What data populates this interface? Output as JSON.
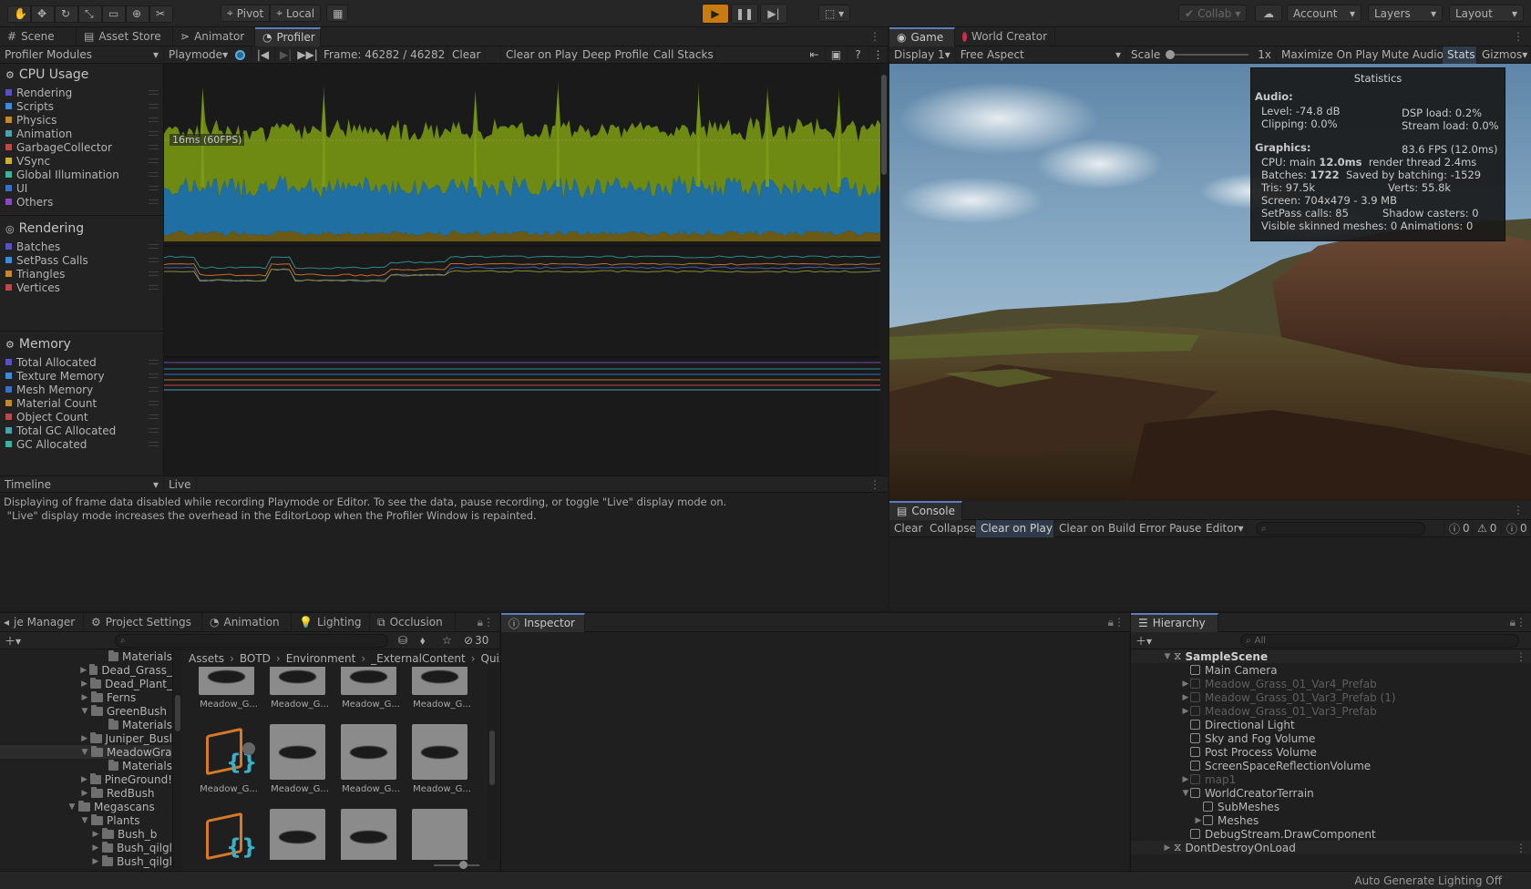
{
  "toolbar": {
    "pivot": "Pivot",
    "local": "Local",
    "collab": "Collab",
    "account": "Account",
    "layers": "Layers",
    "layout": "Layout"
  },
  "left_tabs": [
    "Scene",
    "Asset Store",
    "Animator",
    "Profiler"
  ],
  "profiler": {
    "modules_label": "Profiler Modules",
    "playmode": "Playmode",
    "frame": "Frame: 46282 / 46282",
    "clear": "Clear",
    "clear_on_play": "Clear on Play",
    "deep_profile": "Deep Profile",
    "call_stacks": "Call Stacks",
    "fps_marker": "16ms (60FPS)",
    "cpu": {
      "title": "CPU Usage",
      "items": [
        {
          "label": "Rendering",
          "color": "#5b4fc4"
        },
        {
          "label": "Scripts",
          "color": "#3d8ad6"
        },
        {
          "label": "Physics",
          "color": "#c08a2a"
        },
        {
          "label": "Animation",
          "color": "#4aa3a8"
        },
        {
          "label": "GarbageCollector",
          "color": "#b94a4a"
        },
        {
          "label": "VSync",
          "color": "#c8b430"
        },
        {
          "label": "Global Illumination",
          "color": "#3bb39a"
        },
        {
          "label": "UI",
          "color": "#3a6fc4"
        },
        {
          "label": "Others",
          "color": "#8a4ab8"
        }
      ]
    },
    "rendering": {
      "title": "Rendering",
      "items": [
        {
          "label": "Batches",
          "color": "#5b4fc4"
        },
        {
          "label": "SetPass Calls",
          "color": "#3d8ad6"
        },
        {
          "label": "Triangles",
          "color": "#c08a2a"
        },
        {
          "label": "Vertices",
          "color": "#b94a4a"
        }
      ]
    },
    "memory": {
      "title": "Memory",
      "items": [
        {
          "label": "Total Allocated",
          "color": "#5b4fc4"
        },
        {
          "label": "Texture Memory",
          "color": "#3d8ad6"
        },
        {
          "label": "Mesh Memory",
          "color": "#3a6fc4"
        },
        {
          "label": "Material Count",
          "color": "#c08a2a"
        },
        {
          "label": "Object Count",
          "color": "#b94a4a"
        },
        {
          "label": "Total GC Allocated",
          "color": "#4aa3a8"
        },
        {
          "label": "GC Allocated",
          "color": "#3bb39a"
        }
      ]
    },
    "timeline_label": "Timeline",
    "live_label": "Live",
    "message_line1": "Displaying of frame data disabled while recording Playmode or Editor. To see the data, pause recording, or toggle \"Live\" display mode on.",
    "message_line2": " \"Live\" display mode increases the overhead in the EditorLoop when the Profiler Window is repainted."
  },
  "game": {
    "tab": "Game",
    "tab2": "World Creator",
    "display": "Display 1",
    "aspect": "Free Aspect",
    "scale_label": "Scale",
    "scale_value": "1x",
    "maximize": "Maximize On Play",
    "mute": "Mute Audio",
    "stats": "Stats",
    "gizmos": "Gizmos"
  },
  "stats": {
    "title": "Statistics",
    "audio_label": "Audio:",
    "level": "Level: -74.8 dB",
    "dsp": "DSP load: 0.2%",
    "clipping": "Clipping: 0.0%",
    "stream": "Stream load: 0.0%",
    "graphics_label": "Graphics:",
    "fps": "83.6 FPS (12.0ms)",
    "cpu_prefix": "CPU: main ",
    "cpu_main": "12.0ms",
    "cpu_suffix": "  render thread 2.4ms",
    "batches_prefix": "Batches: ",
    "batches": "1722",
    "saved": "  Saved by batching: -1529",
    "tris": "Tris: 97.5k",
    "verts": "Verts: 55.8k",
    "screen": "Screen: 704x479 - 3.9 MB",
    "setpass": "SetPass calls: 85",
    "shadow": "Shadow casters: 0",
    "skinned": "Visible skinned meshes: 0  Animations: 0"
  },
  "console": {
    "tab": "Console",
    "clear": "Clear",
    "collapse": "Collapse",
    "clear_on_play": "Clear on Play",
    "clear_on_build": "Clear on Build",
    "error_pause": "Error Pause",
    "editor": "Editor",
    "count_info": "0",
    "count_warn": "0",
    "count_err": "0"
  },
  "bottom_tabs": [
    "je Manager",
    "Project Settings",
    "Animation",
    "Lighting",
    "Occlusion"
  ],
  "project": {
    "hidden_count": "30",
    "tree": [
      {
        "label": "Materials",
        "indent": 108,
        "caret": ""
      },
      {
        "label": "Dead_Grass_",
        "indent": 88,
        "caret": "▶"
      },
      {
        "label": "Dead_Plant_",
        "indent": 88,
        "caret": "▶"
      },
      {
        "label": "Ferns",
        "indent": 88,
        "caret": "▶"
      },
      {
        "label": "GreenBush",
        "indent": 88,
        "caret": "▼"
      },
      {
        "label": "Materials",
        "indent": 108,
        "caret": ""
      },
      {
        "label": "Juniper_Busl",
        "indent": 88,
        "caret": "▶"
      },
      {
        "label": "MeadowGra",
        "indent": 88,
        "caret": "▼"
      },
      {
        "label": "Materials",
        "indent": 108,
        "caret": ""
      },
      {
        "label": "PineGround!",
        "indent": 88,
        "caret": "▶"
      },
      {
        "label": "RedBush",
        "indent": 88,
        "caret": "▶"
      },
      {
        "label": "Megascans",
        "indent": 74,
        "caret": "▼"
      },
      {
        "label": "Plants",
        "indent": 88,
        "caret": "▼"
      },
      {
        "label": "Bush_b",
        "indent": 100,
        "caret": "▶"
      },
      {
        "label": "Bush_qilgl",
        "indent": 100,
        "caret": "▶"
      },
      {
        "label": "Bush_qilgl",
        "indent": 100,
        "caret": "▶"
      }
    ],
    "breadcrumb": [
      "Assets",
      "BOTD",
      "Environment",
      "_ExternalContent",
      "Quixe"
    ],
    "asset_label": "Meadow_G..."
  },
  "inspector": {
    "tab": "Inspector"
  },
  "hierarchy": {
    "tab": "Hierarchy",
    "search_placeholder": "All",
    "scene": "SampleScene",
    "items": [
      {
        "label": "Main Camera",
        "indent": 20,
        "faded": false,
        "caret": ""
      },
      {
        "label": "Meadow_Grass_01_Var4_Prefab",
        "indent": 20,
        "faded": true,
        "caret": "▶"
      },
      {
        "label": "Meadow_Grass_01_Var3_Prefab (1)",
        "indent": 20,
        "faded": true,
        "caret": "▶"
      },
      {
        "label": "Meadow_Grass_01_Var3_Prefab",
        "indent": 20,
        "faded": true,
        "caret": "▶"
      },
      {
        "label": "Directional Light",
        "indent": 20,
        "faded": false,
        "caret": ""
      },
      {
        "label": "Sky and Fog Volume",
        "indent": 20,
        "faded": false,
        "caret": ""
      },
      {
        "label": "Post Process Volume",
        "indent": 20,
        "faded": false,
        "caret": ""
      },
      {
        "label": "ScreenSpaceReflectionVolume",
        "indent": 20,
        "faded": false,
        "caret": ""
      },
      {
        "label": "map1",
        "indent": 20,
        "faded": true,
        "caret": "▶"
      },
      {
        "label": "WorldCreatorTerrain",
        "indent": 20,
        "faded": false,
        "caret": "▼"
      },
      {
        "label": "SubMeshes",
        "indent": 34,
        "faded": false,
        "caret": ""
      },
      {
        "label": "Meshes",
        "indent": 34,
        "faded": false,
        "caret": "▶"
      },
      {
        "label": "DebugStream.DrawComponent",
        "indent": 20,
        "faded": false,
        "caret": ""
      }
    ],
    "dont_destroy": "DontDestroyOnLoad"
  },
  "status_bar": "Auto Generate Lighting Off"
}
